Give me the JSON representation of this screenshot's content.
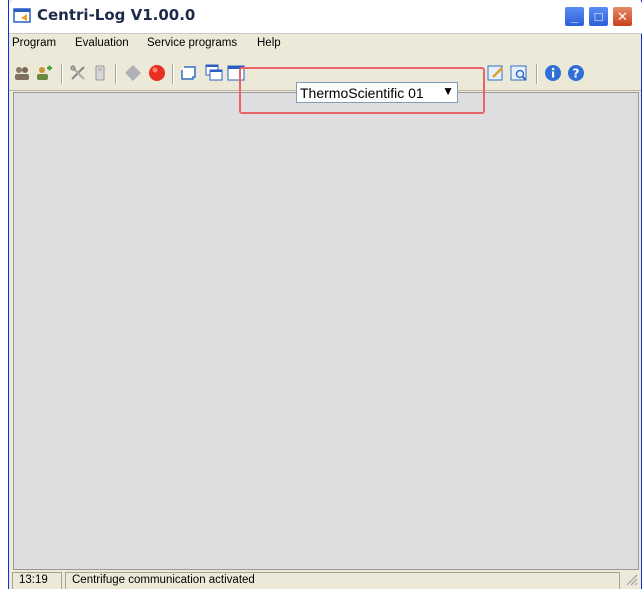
{
  "window": {
    "title": "Centri-Log V1.00.0"
  },
  "menu": {
    "items": [
      "Program",
      "Evaluation",
      "Service programs",
      "Help"
    ]
  },
  "toolbar": {
    "device_select": {
      "value": "ThermoScientific 01"
    },
    "icons": [
      "users-icon",
      "user-add-icon",
      "tools-icon",
      "device-icon",
      "diamond-icon",
      "stop-icon",
      "scroll-icon",
      "cascade-windows-icon",
      "window-icon",
      "edit-report-icon",
      "preview-report-icon",
      "info-icon",
      "help-icon"
    ]
  },
  "status": {
    "time": "13:19",
    "message": "Centrifuge communication activated"
  },
  "colors": {
    "highlight": "#e8636a",
    "client_bg": "#dedee0"
  }
}
